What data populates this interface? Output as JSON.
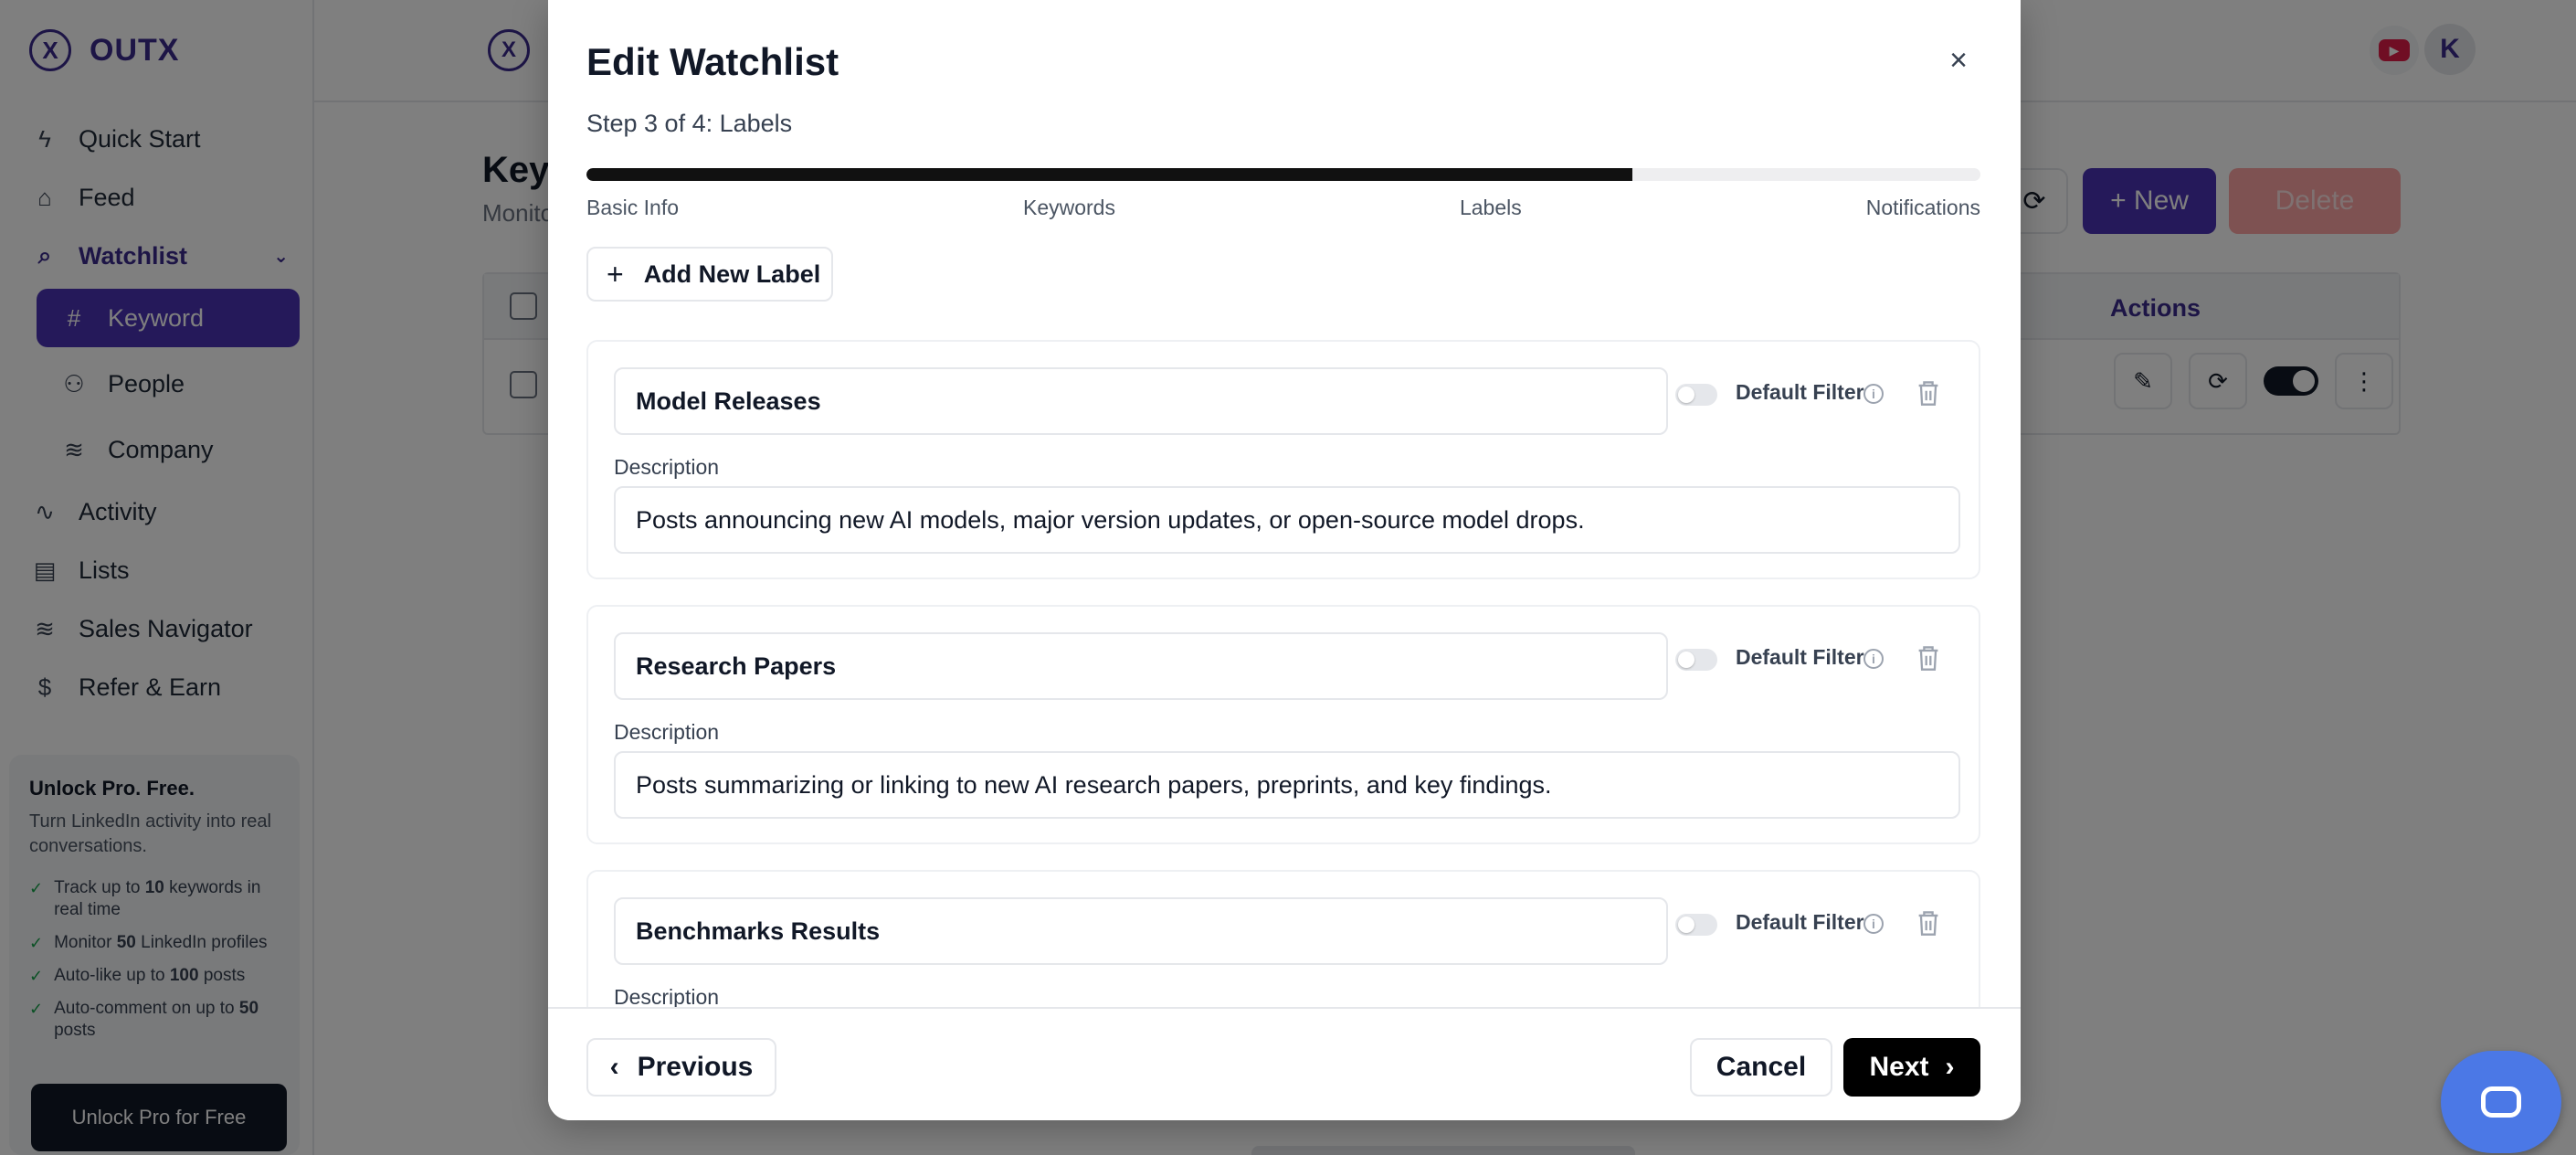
{
  "app": {
    "brand": "OUTX",
    "logo_glyph": "X",
    "avatar_initial": "K"
  },
  "sidebar": {
    "items": [
      {
        "label": "Quick Start",
        "icon": "lightning-icon"
      },
      {
        "label": "Feed",
        "icon": "home-icon"
      },
      {
        "label": "Watchlist",
        "icon": "search-icon"
      },
      {
        "label": "Keyword",
        "icon": "hash-icon"
      },
      {
        "label": "People",
        "icon": "users-icon"
      },
      {
        "label": "Company",
        "icon": "database-icon"
      },
      {
        "label": "Activity",
        "icon": "activity-icon"
      },
      {
        "label": "Lists",
        "icon": "file-icon"
      },
      {
        "label": "Sales Navigator",
        "icon": "database-icon"
      },
      {
        "label": "Refer & Earn",
        "icon": "dollar-icon"
      }
    ]
  },
  "promo": {
    "title": "Unlock Pro. Free.",
    "subtitle": "Turn LinkedIn activity into real conversations.",
    "features": [
      {
        "pre": "Track up to ",
        "bold": "10",
        "post": " keywords in real time"
      },
      {
        "pre": "Monitor ",
        "bold": "50",
        "post": " LinkedIn profiles"
      },
      {
        "pre": "Auto-like up to ",
        "bold": "100",
        "post": " posts"
      },
      {
        "pre": "Auto-comment on up to ",
        "bold": "50",
        "post": " posts"
      }
    ],
    "button": "Unlock Pro for Free"
  },
  "page": {
    "title_partial": "Keyw",
    "subtitle_partial": "Monito",
    "new_button": "+ New",
    "delete_button": "Delete",
    "table_actions_header": "Actions"
  },
  "modal": {
    "title": "Edit Watchlist",
    "step_text": "Step 3 of 4: Labels",
    "progress_fraction": 0.75,
    "steps": [
      "Basic Info",
      "Keywords",
      "Labels",
      "Notifications"
    ],
    "add_label_button": "Add New Label",
    "default_filter_label": "Default Filter",
    "description_label": "Description",
    "labels": [
      {
        "name": "Model Releases",
        "description": "Posts announcing new AI models, major version updates, or open-source model drops."
      },
      {
        "name": "Research Papers",
        "description": "Posts summarizing or linking to new AI research papers, preprints, and key findings."
      },
      {
        "name": "Benchmarks Results",
        "description": ""
      }
    ],
    "footer": {
      "previous": "Previous",
      "cancel": "Cancel",
      "next": "Next"
    }
  }
}
